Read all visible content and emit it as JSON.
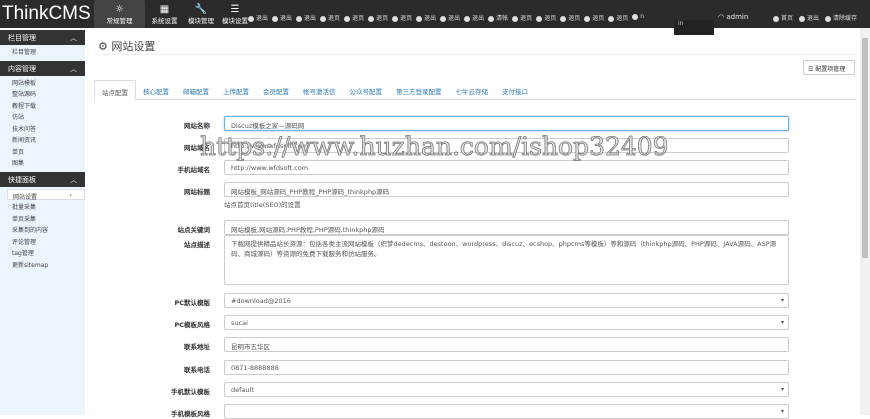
{
  "topbar": {
    "logo": "ThinkCMS",
    "nav": [
      {
        "label": "常规管理",
        "icon": "☼"
      },
      {
        "label": "系统设置",
        "icon": "▦"
      },
      {
        "label": "模块管理",
        "icon": "🔧"
      },
      {
        "label": "模块设置",
        "icon": "☰"
      }
    ],
    "links": [
      "退出",
      "退出",
      "退出",
      "退页",
      "退页",
      "退页",
      "退页",
      "退出",
      "退出",
      "退出",
      "清帐",
      "退页",
      "退页",
      "退页",
      "退页",
      "退页",
      "n"
    ],
    "dark_box": "in",
    "user": "admin",
    "right": [
      "首页",
      "退出",
      "清除缓存"
    ]
  },
  "sidebar": {
    "groups": [
      {
        "title": "栏目管理",
        "items": [
          "栏目管理"
        ]
      },
      {
        "title": "内容管理",
        "items": [
          "网站模板",
          "整站源码",
          "教程下载",
          "仿站",
          "技术问答",
          "新闻资讯",
          "单页",
          "图集"
        ]
      },
      {
        "title": "快捷面板",
        "items": [
          "网站设置",
          "批量采集",
          "单页采集",
          "采集到的内容",
          "评论管理",
          "tag管理",
          "更新sitemap"
        ]
      }
    ],
    "active": "网站设置"
  },
  "page": {
    "title": "网站设置",
    "config_button": "配置项管理",
    "tabs": [
      "站点配置",
      "核心配置",
      "邮箱配置",
      "上传配置",
      "会员配置",
      "帐号激活信",
      "公众号配置",
      "第三方登录配置",
      "七牛云存储",
      "支付接口"
    ]
  },
  "form": {
    "site_name": {
      "label": "网站名称",
      "value": "Discuz模板之家—源码网"
    },
    "domain": {
      "label": "网站域名",
      "value": "http://www.wfdsoft.com"
    },
    "mobile_domain": {
      "label": "手机站域名",
      "value": "http://www.wfdsoft.com"
    },
    "site_title": {
      "label": "网站标题",
      "value": "网站模板_网站源码_PHP教程_PHP源码_thinkphp源码",
      "help": "站点首页title(SEO)的设置"
    },
    "keywords": {
      "label": "站点关键词",
      "value": "网站模板,网站源码,PHP教程,PHP源码,thinkphp源码"
    },
    "description": {
      "label": "站点描述",
      "value": "下载网提供精品站长资源：包括各类主流网站模板（织梦dedecms、destoon、wordpress、discuz、ecshop、phpcms等模板）等和源码（thinkphp源码、PHP源码、JAVA源码、ASP源码、商城源码）等资源的免费下载服务和仿站服务。"
    },
    "pc_template": {
      "label": "PC默认模版",
      "value": "#download@2016"
    },
    "pc_style": {
      "label": "PC模板风格",
      "value": "sucai"
    },
    "address": {
      "label": "联系地址",
      "value": "昆明市五华区"
    },
    "phone": {
      "label": "联系电话",
      "value": "0871-8888888"
    },
    "mobile_template": {
      "label": "手机默认模板",
      "value": "default"
    },
    "mobile_style": {
      "label": "手机模板风格",
      "value": ""
    }
  },
  "watermark": "https://www.huzhan.com/ishop32409"
}
